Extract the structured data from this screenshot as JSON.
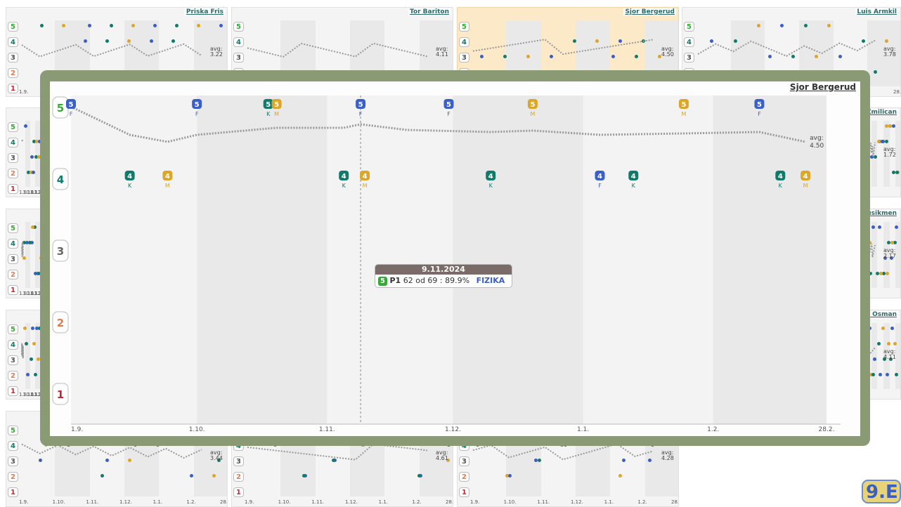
{
  "class_label": "9.E",
  "panels": [
    {
      "name": "Priska Fris",
      "avg": "3.22",
      "highlight": false
    },
    {
      "name": "Tor Bariton",
      "avg": "4.11",
      "highlight": false
    },
    {
      "name": "Sjor Bergerud",
      "avg": "4.50",
      "highlight": true
    },
    {
      "name": "Luis Armkil",
      "avg": "3.78",
      "highlight": false
    },
    {
      "name": "ija Zmilican",
      "avg": "1.72",
      "highlight": false
    },
    {
      "name": "x Musikmen",
      "avg": "2.17",
      "highlight": false
    },
    {
      "name": "urak Osman",
      "avg": "4.11",
      "highlight": false
    },
    {
      "name": "",
      "avg": "3.44",
      "highlight": false
    },
    {
      "name": "",
      "avg": "4.61",
      "highlight": false
    },
    {
      "name": "",
      "avg": "4.28",
      "highlight": false
    }
  ],
  "panel_dates": [
    "1.9.",
    "1.10.",
    "1.11.",
    "1.12.",
    "1.1.",
    "1.2.",
    "28.2."
  ],
  "avg_label": "avg:",
  "tooltip": {
    "date": "9.11.2024",
    "grade": "5",
    "period": "P1",
    "detail": "62 od 69 : 89.9%",
    "subject": "FIZIKA"
  },
  "chart_data": {
    "type": "scatter",
    "title": "Sjor Bergerud",
    "x_axis": {
      "range": [
        "2024-09-01",
        "2025-02-28"
      ],
      "tick_labels": [
        "1.9.",
        "1.10.",
        "1.11.",
        "1.12.",
        "1.1.",
        "1.2.",
        "28.2."
      ],
      "tick_dates": [
        "2024-09-01",
        "2024-10-01",
        "2024-11-01",
        "2024-12-01",
        "2025-01-01",
        "2025-02-01",
        "2025-02-28"
      ]
    },
    "y_axis": {
      "levels": [
        5,
        4,
        3,
        2,
        1
      ]
    },
    "grade_colors": {
      "5": "#33aa33",
      "4": "#127a6a",
      "3": "#666666",
      "2": "#e07a50",
      "1": "#cc2233"
    },
    "subject_colors": {
      "F": "#3b5fc9",
      "K": "#127a6a",
      "M": "#dba62a"
    },
    "points": [
      {
        "date": "2024-09-01",
        "grade": 5,
        "subject": "F"
      },
      {
        "date": "2024-09-15",
        "grade": 4,
        "subject": "K"
      },
      {
        "date": "2024-09-24",
        "grade": 4,
        "subject": "M"
      },
      {
        "date": "2024-10-01",
        "grade": 5,
        "subject": "F"
      },
      {
        "date": "2024-10-18",
        "grade": 5,
        "subject": "K"
      },
      {
        "date": "2024-10-20",
        "grade": 5,
        "subject": "M"
      },
      {
        "date": "2024-11-05",
        "grade": 4,
        "subject": "K"
      },
      {
        "date": "2024-11-09",
        "grade": 5,
        "subject": "F"
      },
      {
        "date": "2024-11-10",
        "grade": 4,
        "subject": "M"
      },
      {
        "date": "2024-11-30",
        "grade": 5,
        "subject": "F"
      },
      {
        "date": "2024-12-10",
        "grade": 4,
        "subject": "K"
      },
      {
        "date": "2024-12-20",
        "grade": 5,
        "subject": "M"
      },
      {
        "date": "2025-01-05",
        "grade": 4,
        "subject": "F"
      },
      {
        "date": "2025-01-13",
        "grade": 4,
        "subject": "K"
      },
      {
        "date": "2025-01-25",
        "grade": 5,
        "subject": "M"
      },
      {
        "date": "2025-02-12",
        "grade": 5,
        "subject": "F"
      },
      {
        "date": "2025-02-17",
        "grade": 4,
        "subject": "K"
      },
      {
        "date": "2025-02-23",
        "grade": 4,
        "subject": "M"
      }
    ],
    "running_average": {
      "dates": [
        "2024-09-01",
        "2024-09-15",
        "2024-09-24",
        "2024-10-01",
        "2024-10-20",
        "2024-11-05",
        "2024-11-09",
        "2024-11-20",
        "2024-12-10",
        "2024-12-20",
        "2025-01-05",
        "2025-01-25",
        "2025-02-12",
        "2025-02-23"
      ],
      "values": [
        5.0,
        4.6,
        4.5,
        4.6,
        4.7,
        4.7,
        4.75,
        4.67,
        4.64,
        4.66,
        4.6,
        4.62,
        4.64,
        4.5
      ],
      "label": "avg:",
      "final": "4.50"
    },
    "tooltip_date": "2024-11-09"
  }
}
